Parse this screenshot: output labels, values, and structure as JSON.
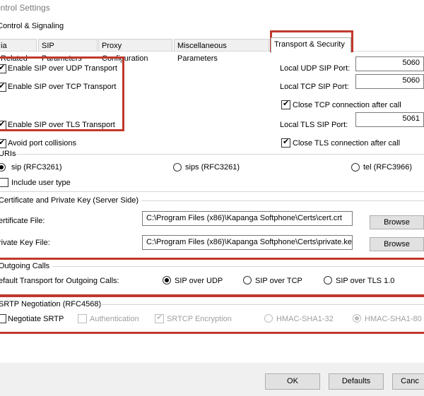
{
  "window": {
    "title": "ontrol Settings"
  },
  "group_label": "Control & Signaling",
  "tabs": [
    {
      "label": "ia Related"
    },
    {
      "label": "SIP Parameters"
    },
    {
      "label": "Proxy Configuration"
    },
    {
      "label": "Miscellaneous Parameters"
    },
    {
      "label": "Transport & Security",
      "active": true
    }
  ],
  "transport": {
    "udp_label": "Enable SIP over UDP Transport",
    "tcp_label": "Enable SIP over TCP Transport",
    "tls_label": "Enable SIP over TLS Transport",
    "avoid_label": "Avoid port collisions",
    "udp_port_label": "Local UDP SIP Port:",
    "udp_port": "5060",
    "tcp_port_label": "Local TCP SIP Port:",
    "tcp_port": "5060",
    "close_tcp_label": "Close TCP connection after call",
    "tls_port_label": "Local TLS SIP Port:",
    "tls_port": "5061",
    "close_tls_label": "Close TLS connection after call"
  },
  "uris": {
    "section": "URIs",
    "sip": "sip (RFC3261)",
    "sips": "sips (RFC3261)",
    "tel": "tel (RFC3966)",
    "user_type": "Include user type"
  },
  "certs": {
    "section": "Certificate and Private Key (Server Side)",
    "cert_label": "ertificate File:",
    "cert_path": "C:\\Program Files (x86)\\Kapanga Softphone\\Certs\\cert.crt",
    "key_label": "rivate Key File:",
    "key_path": "C:\\Program Files (x86)\\Kapanga Softphone\\Certs\\private.key",
    "browse": "Browse"
  },
  "outgoing": {
    "section": "Outgoing Calls",
    "default_label": "efault Transport for Outgoing Calls:",
    "udp": "SIP over UDP",
    "tcp": "SIP over TCP",
    "tls": "SIP over TLS 1.0"
  },
  "srtp": {
    "section": "SRTP Negotiation (RFC4568)",
    "negotiate": "Negotiate SRTP",
    "auth": "Authentication",
    "srtcp": "SRTCP Encryption",
    "hmac32": "HMAC-SHA1-32",
    "hmac80": "HMAC-SHA1-80"
  },
  "footer": {
    "ok": "OK",
    "defaults": "Defaults",
    "cancel": "Canc"
  },
  "colors": {
    "highlight": "#c0392b"
  }
}
